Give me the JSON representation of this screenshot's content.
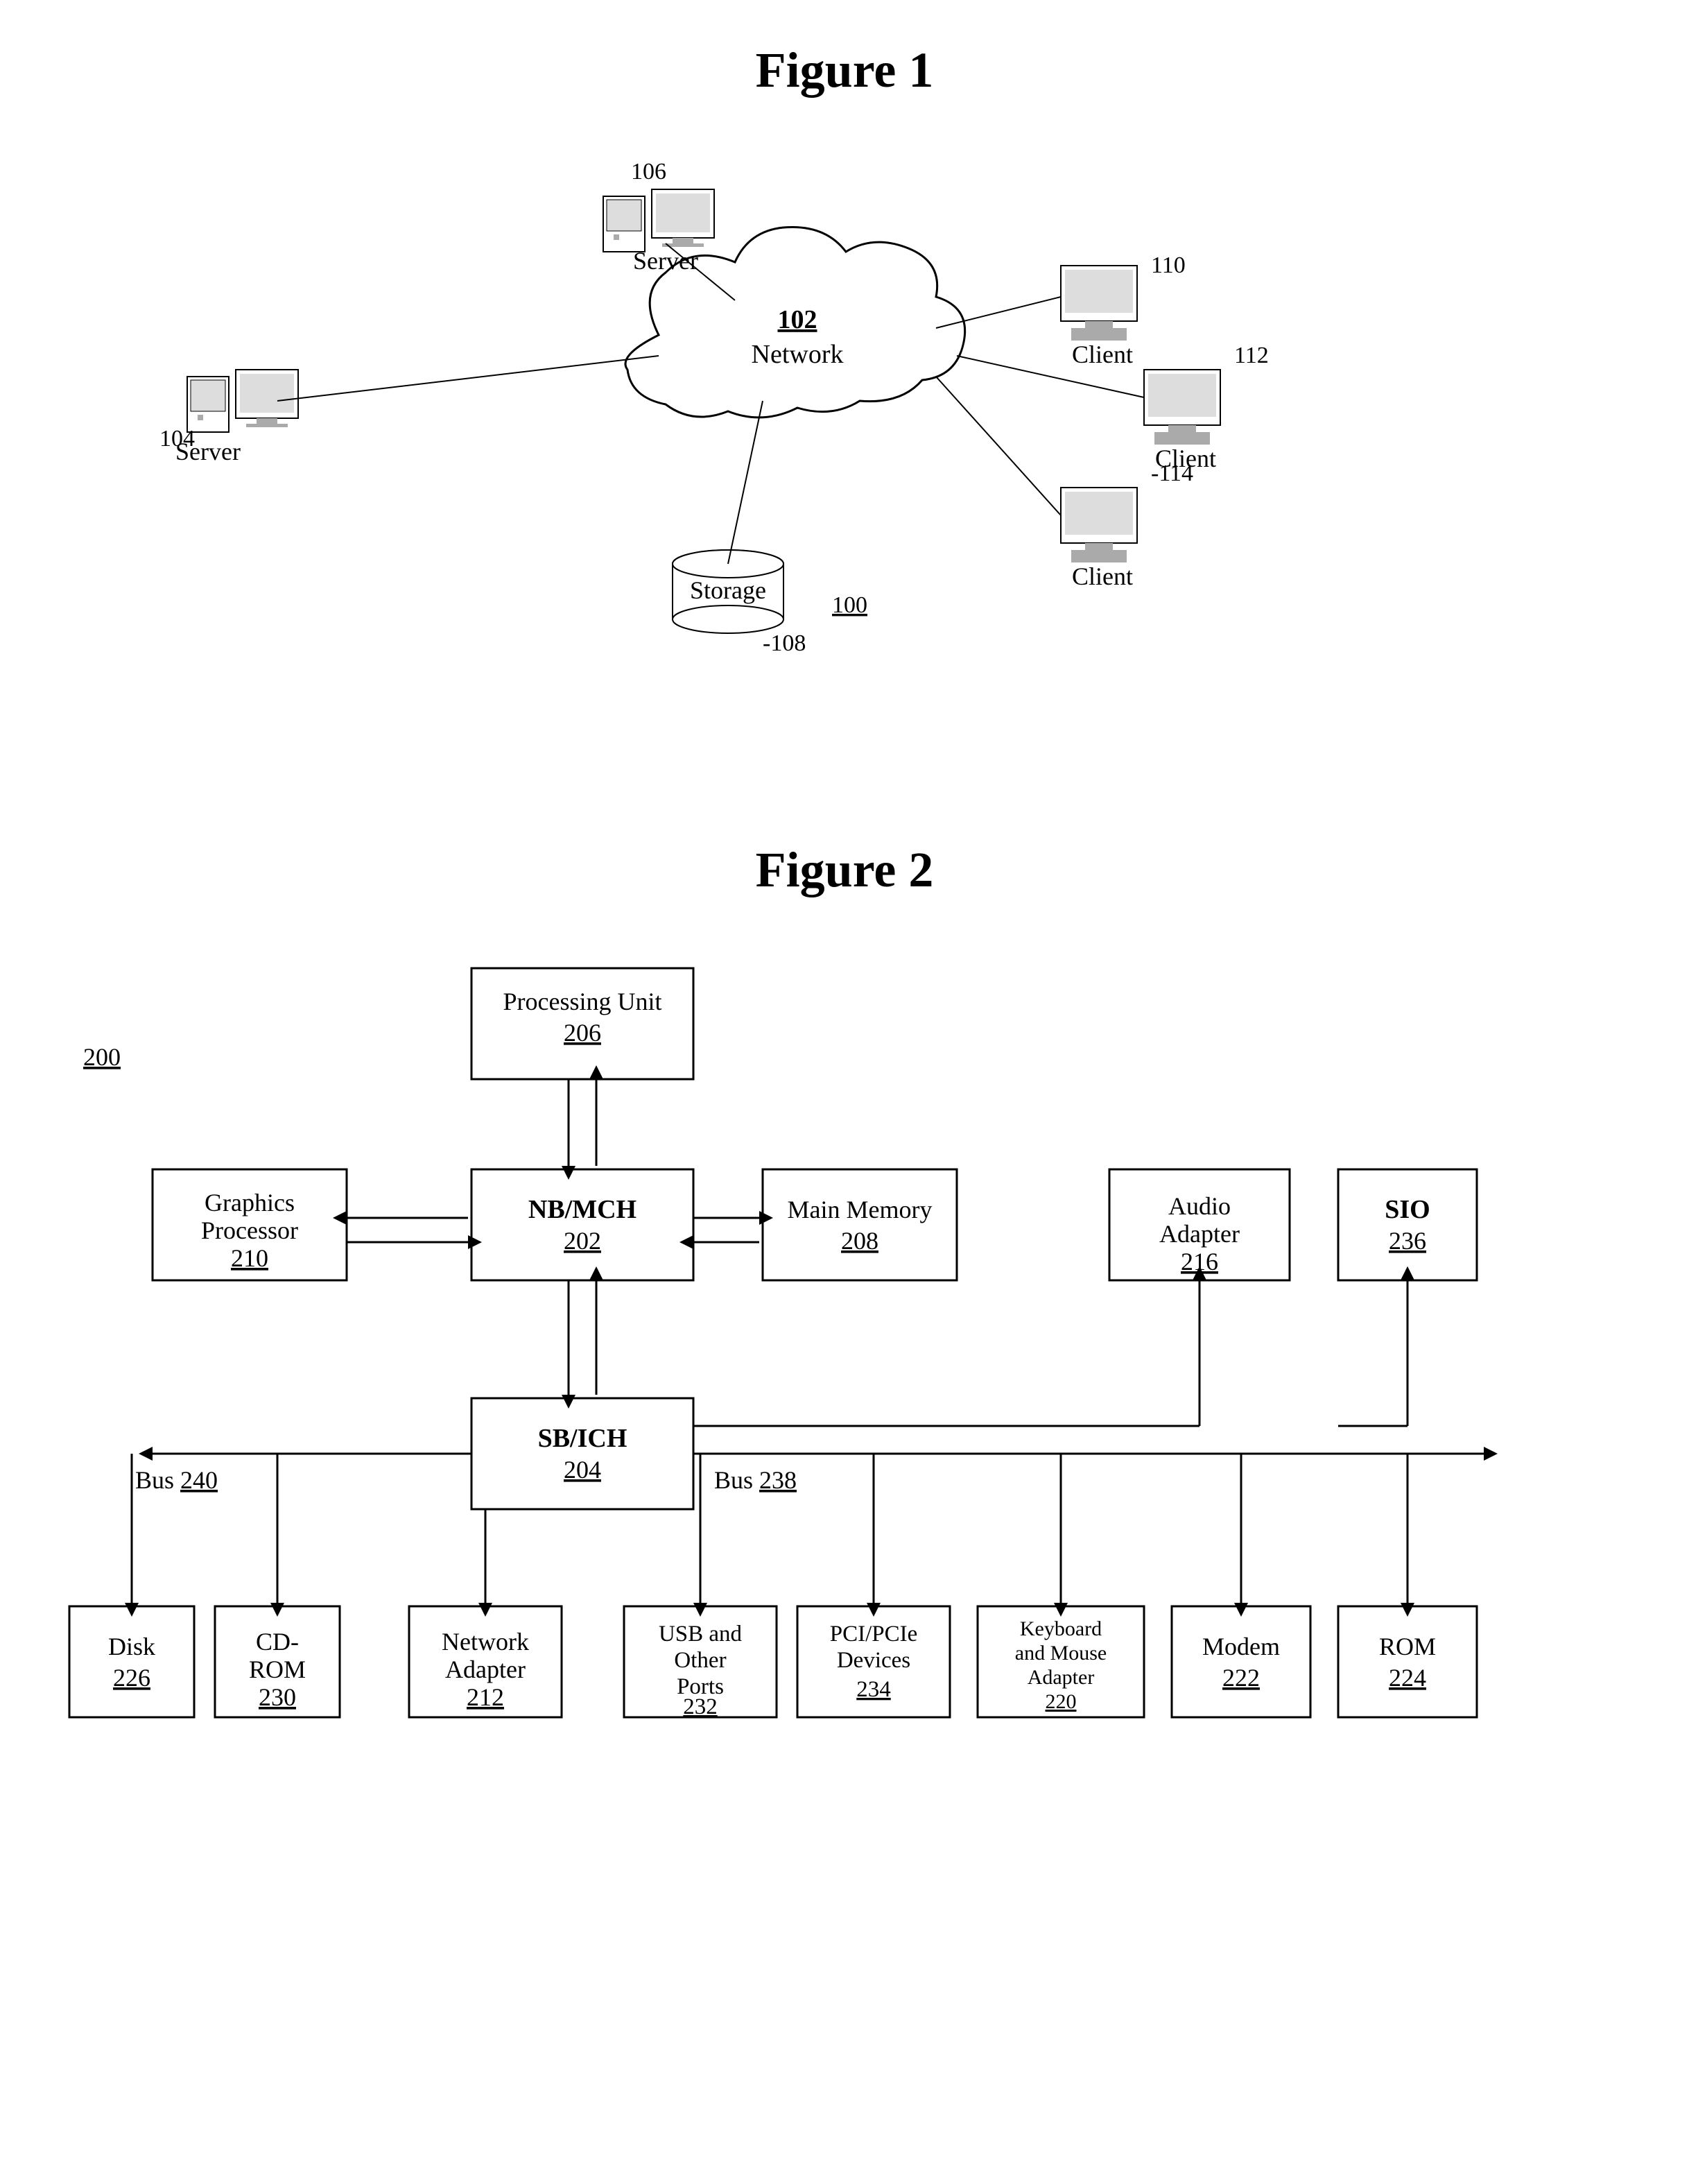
{
  "figure1": {
    "title": "Figure 1",
    "nodes": {
      "network": {
        "label": "Network",
        "ref": "102"
      },
      "server1": {
        "label": "Server",
        "ref": "104"
      },
      "server2": {
        "label": "Server",
        "ref": "106"
      },
      "storage": {
        "label": "Storage",
        "ref": "108"
      },
      "client1": {
        "label": "Client",
        "ref": "110"
      },
      "client2": {
        "label": "Client",
        "ref": "112"
      },
      "client3": {
        "label": "Client",
        "ref": "114"
      },
      "system_ref": "100"
    }
  },
  "figure2": {
    "title": "Figure 2",
    "nodes": {
      "system_ref": "200",
      "processing_unit": {
        "label": "Processing Unit",
        "ref": "206"
      },
      "nb_mch": {
        "label": "NB/MCH",
        "ref": "202"
      },
      "main_memory": {
        "label": "Main Memory",
        "ref": "208"
      },
      "sb_ich": {
        "label": "SB/ICH",
        "ref": "204"
      },
      "graphics_processor": {
        "label": "Graphics Processor",
        "ref": "210"
      },
      "audio_adapter": {
        "label": "Audio Adapter",
        "ref": "216"
      },
      "sio": {
        "label": "SIO",
        "ref": "236"
      },
      "bus240": {
        "label": "Bus",
        "ref": "240"
      },
      "bus238": {
        "label": "Bus",
        "ref": "238"
      },
      "disk": {
        "label": "Disk",
        "ref": "226"
      },
      "cd_rom": {
        "label": "CD-ROM",
        "ref": "230"
      },
      "network_adapter": {
        "label": "Network Adapter",
        "ref": "212"
      },
      "usb_ports": {
        "label": "USB and Other Ports",
        "ref": "232"
      },
      "pci_devices": {
        "label": "PCI/PCIe Devices",
        "ref": "234"
      },
      "keyboard_mouse": {
        "label": "Keyboard and Mouse Adapter",
        "ref": "220"
      },
      "modem": {
        "label": "Modem",
        "ref": "222"
      },
      "rom": {
        "label": "ROM",
        "ref": "224"
      }
    }
  }
}
